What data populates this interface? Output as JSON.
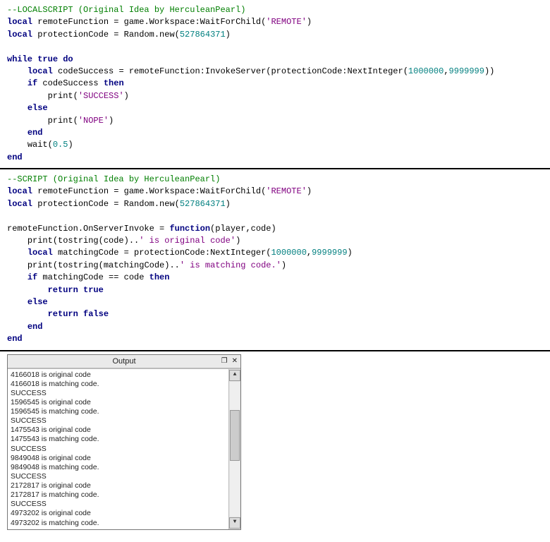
{
  "code1": {
    "c1": "--LOCALSCRIPT (Original Idea by HerculeanPearl)",
    "l2a": "local",
    "l2b": " remoteFunction = game.Workspace:WaitForChild(",
    "l2c": "'REMOTE'",
    "l2d": ")",
    "l3a": "local",
    "l3b": " protectionCode = Random.new(",
    "l3c": "527864371",
    "l3d": ")",
    "l5a": "while",
    "l5b": " ",
    "l5c": "true",
    "l5d": " ",
    "l5e": "do",
    "l6a": "local",
    "l6b": " codeSuccess = remoteFunction:InvokeServer(protectionCode:NextInteger(",
    "l6c": "1000000",
    "l6d": ",",
    "l6e": "9999999",
    "l6f": "))",
    "l7a": "if",
    "l7b": " codeSuccess ",
    "l7c": "then",
    "l8a": "print(",
    "l8b": "'SUCCESS'",
    "l8c": ")",
    "l9a": "else",
    "l10a": "print(",
    "l10b": "'NOPE'",
    "l10c": ")",
    "l11a": "end",
    "l12a": "wait(",
    "l12b": "0.5",
    "l12c": ")",
    "l13a": "end"
  },
  "code2": {
    "c1": "--SCRIPT (Original Idea by HerculeanPearl)",
    "l2a": "local",
    "l2b": " remoteFunction = game.Workspace:WaitForChild(",
    "l2c": "'REMOTE'",
    "l2d": ")",
    "l3a": "local",
    "l3b": " protectionCode = Random.new(",
    "l3c": "527864371",
    "l3d": ")",
    "l5a": "remoteFunction.OnServerInvoke = ",
    "l5b": "function",
    "l5c": "(player,code)",
    "l6a": "print(tostring(code)..",
    "l6b": "' is original code'",
    "l6c": ")",
    "l7a": "local",
    "l7b": " matchingCode = protectionCode:NextInteger(",
    "l7c": "1000000",
    "l7d": ",",
    "l7e": "9999999",
    "l7f": ")",
    "l8a": "print(tostring(matchingCode)..",
    "l8b": "' is matching code.'",
    "l8c": ")",
    "l9a": "if",
    "l9b": " matchingCode == code ",
    "l9c": "then",
    "l10a": "return",
    "l10b": " ",
    "l10c": "true",
    "l11a": "else",
    "l12a": "return",
    "l12b": " ",
    "l12c": "false",
    "l13a": "end",
    "l14a": "end"
  },
  "output": {
    "title": "Output",
    "undock_icon": "❐",
    "close_icon": "✕",
    "up_icon": "▲",
    "down_icon": "▼",
    "lines": [
      "4166018 is original code",
      "4166018 is matching code.",
      "SUCCESS",
      "1596545 is original code",
      "1596545 is matching code.",
      "SUCCESS",
      "1475543 is original code",
      "1475543 is matching code.",
      "SUCCESS",
      "9849048 is original code",
      "9849048 is matching code.",
      "SUCCESS",
      "2172817 is original code",
      "2172817 is matching code.",
      "SUCCESS",
      "4973202 is original code",
      "4973202 is matching code."
    ]
  }
}
